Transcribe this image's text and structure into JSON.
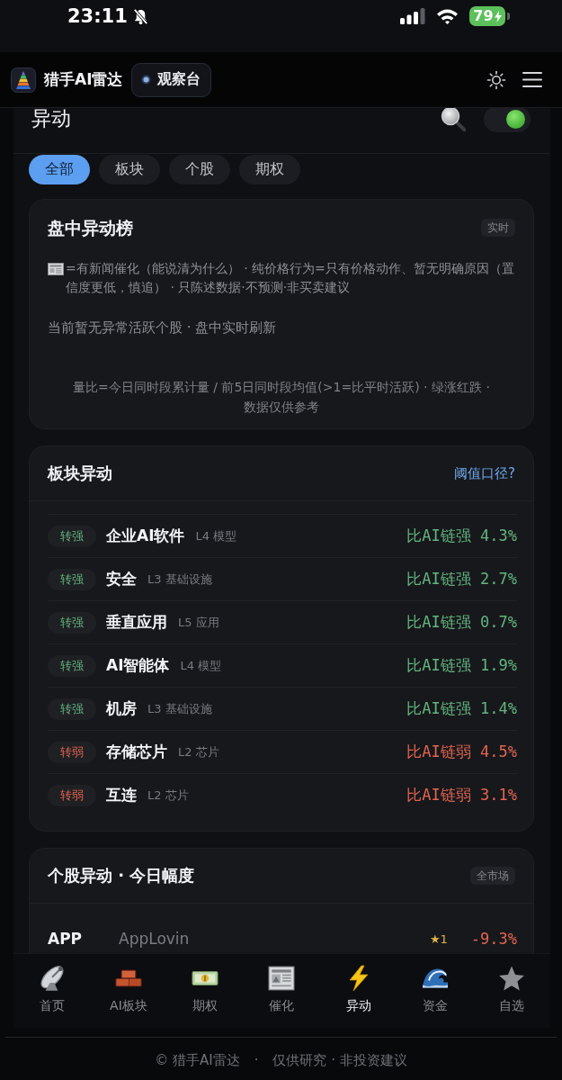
{
  "status_bar": {
    "time": "23:11",
    "battery": "79"
  },
  "header": {
    "app_name": "猎手AI雷达",
    "mode_button": "观察台"
  },
  "page": {
    "title": "异动",
    "live_toggle": {
      "on": true
    }
  },
  "filters": [
    {
      "label": "全部",
      "selected": true
    },
    {
      "label": "板块",
      "selected": false
    },
    {
      "label": "个股",
      "selected": false
    },
    {
      "label": "期权",
      "selected": false
    }
  ],
  "intraday_card": {
    "title": "盘中异动榜",
    "tag": "实时",
    "legend": "=有新闻催化（能说清为什么） · 纯价格行为=只有价格动作、暂无明确原因（置信度更低，慎追） · 只陈述数据·不预测·非买卖建议",
    "status": "当前暂无异常活跃个股 · 盘中实时刷新",
    "footnote": "量比=今日同时段累计量 / 前5日同时段均值(>1=比平时活跃) · 绿涨红跌 · 数据仅供参考"
  },
  "sector_card": {
    "title": "板块异动",
    "link": "阈值口径?",
    "rows": [
      {
        "kind": "strong",
        "tag": "转强",
        "name": "企业AI软件",
        "layer": "L4 模型",
        "value": "比AI链强 4.3%"
      },
      {
        "kind": "strong",
        "tag": "转强",
        "name": "安全",
        "layer": "L3 基础设施",
        "value": "比AI链强 2.7%"
      },
      {
        "kind": "strong",
        "tag": "转强",
        "name": "垂直应用",
        "layer": "L5 应用",
        "value": "比AI链强 0.7%"
      },
      {
        "kind": "strong",
        "tag": "转强",
        "name": "AI智能体",
        "layer": "L4 模型",
        "value": "比AI链强 1.9%"
      },
      {
        "kind": "strong",
        "tag": "转强",
        "name": "机房",
        "layer": "L3 基础设施",
        "value": "比AI链强 1.4%"
      },
      {
        "kind": "weak",
        "tag": "转弱",
        "name": "存储芯片",
        "layer": "L2 芯片",
        "value": "比AI链弱 4.5%"
      },
      {
        "kind": "weak",
        "tag": "转弱",
        "name": "互连",
        "layer": "L2 芯片",
        "value": "比AI链弱 3.1%"
      }
    ]
  },
  "stock_card": {
    "title": "个股异动 · 今日幅度",
    "tag": "全市场",
    "rows": [
      {
        "kind": "down",
        "ticker": "APP",
        "company": "AppLovin",
        "score": "★1",
        "change": "-9.3%"
      }
    ]
  },
  "tab_bar": [
    {
      "label": "首页",
      "selected": false
    },
    {
      "label": "AI板块",
      "selected": false
    },
    {
      "label": "期权",
      "selected": false
    },
    {
      "label": "催化",
      "selected": false
    },
    {
      "label": "异动",
      "selected": true
    },
    {
      "label": "资金",
      "selected": false
    },
    {
      "label": "自选",
      "selected": false
    }
  ],
  "footer": {
    "brand": "© 猎手AI雷达",
    "separator": "·",
    "note": "仅供研究 · 非投资建议"
  }
}
